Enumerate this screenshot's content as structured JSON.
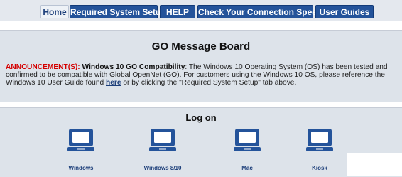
{
  "nav": {
    "tabs": [
      {
        "label": "Home",
        "active": true
      },
      {
        "label": "Required System Setup",
        "active": false
      },
      {
        "label": "HELP",
        "active": false
      },
      {
        "label": "Check Your Connection Speed",
        "active": false
      },
      {
        "label": "User Guides",
        "active": false
      }
    ]
  },
  "board": {
    "title": "GO Message Board",
    "announcement": {
      "lead": "ANNOUNCEMENT(S):",
      "heading": "Windows 10 GO Compatibility",
      "text1": ": The Windows 10 Operating System (OS) has been tested and confirmed to be compatible with Global OpenNet (GO). For customers using the Windows 10 OS, please reference the Windows 10 User Guide found ",
      "link": "here",
      "text2": " or by clicking the \"Required System Setup\" tab above."
    }
  },
  "logon": {
    "title": "Log on",
    "options": [
      {
        "label": "Windows",
        "icon": "laptop-icon"
      },
      {
        "label": "Windows 8/10",
        "icon": "laptop-icon"
      },
      {
        "label": "Mac",
        "icon": "laptop-icon"
      },
      {
        "label": "Kiosk",
        "icon": "laptop-icon"
      }
    ]
  },
  "colors": {
    "tab_bg": "#24539a",
    "panel_bg": "#dde3ea",
    "announcement_lead": "#d40000",
    "icon_blue": "#24539a"
  }
}
